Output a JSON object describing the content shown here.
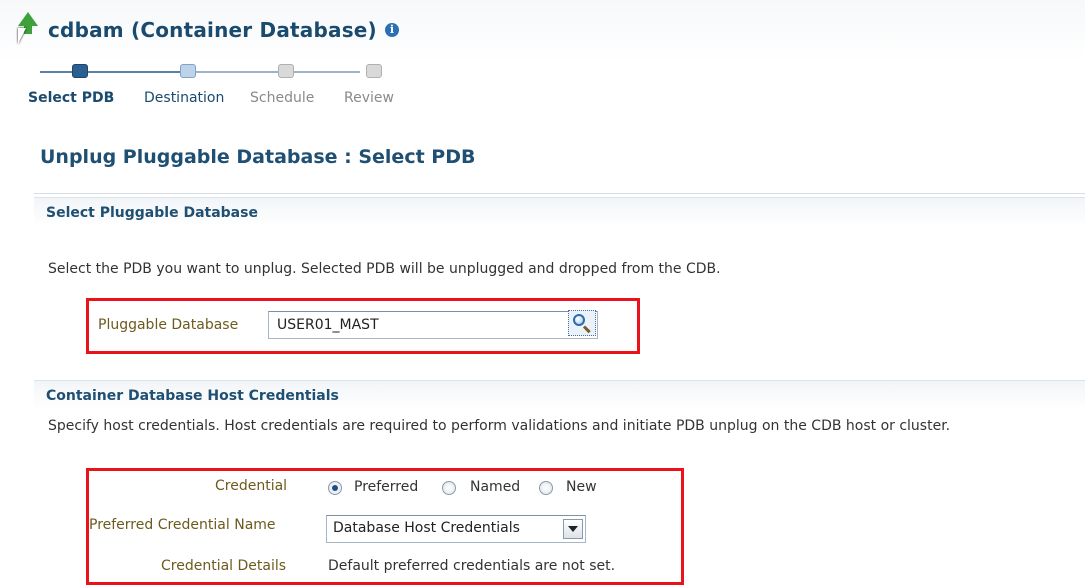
{
  "header": {
    "title": "cdbam (Container Database)",
    "info_icon": "i"
  },
  "train": {
    "steps": [
      {
        "label": "Select PDB",
        "state": "active"
      },
      {
        "label": "Destination",
        "state": "next"
      },
      {
        "label": "Schedule",
        "state": "disabled"
      },
      {
        "label": "Review",
        "state": "disabled"
      }
    ]
  },
  "page": {
    "heading": "Unplug Pluggable Database : Select PDB"
  },
  "select_pdb": {
    "section_title": "Select Pluggable Database",
    "description": "Select the PDB you want to unplug. Selected PDB will be unplugged and dropped from the CDB.",
    "field_label": "Pluggable Database",
    "field_value": "USER01_MAST",
    "search_icon": "search-icon"
  },
  "credentials": {
    "section_title": "Container Database Host Credentials",
    "description": "Specify host credentials. Host credentials are required to perform validations and initiate PDB unplug on the CDB host or cluster.",
    "credential_label": "Credential",
    "options": [
      {
        "label": "Preferred",
        "checked": true
      },
      {
        "label": "Named",
        "checked": false
      },
      {
        "label": "New",
        "checked": false
      }
    ],
    "preferred_name_label": "Preferred Credential Name",
    "preferred_name_value": "Database Host Credentials",
    "details_label": "Credential Details",
    "details_value": "Default preferred credentials are not set."
  },
  "colors": {
    "heading": "#1f4f72",
    "highlight_box": "#e8141a",
    "field_label": "#6d5a1e"
  }
}
